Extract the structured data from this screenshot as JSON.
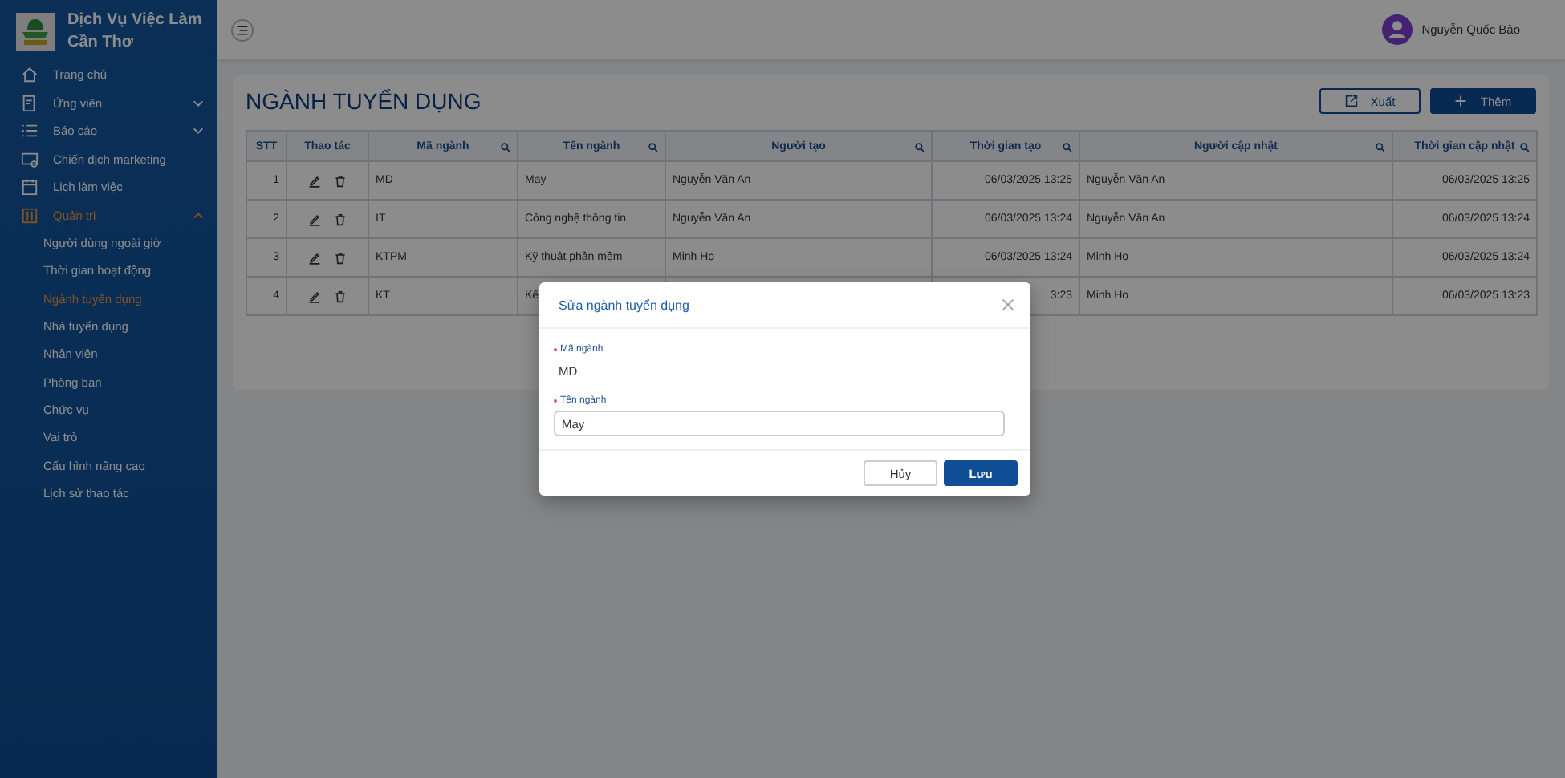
{
  "brand": {
    "title": "Dịch Vụ Việc Làm Cần Thơ"
  },
  "sidebar": {
    "items": [
      {
        "label": "Trang chủ",
        "selected": false
      },
      {
        "label": "Ứng viên",
        "selected": false,
        "expanded": false
      },
      {
        "label": "Báo cáo",
        "selected": false,
        "expanded": false
      },
      {
        "label": "Chiến dịch marketing",
        "selected": false
      },
      {
        "label": "Lịch làm việc",
        "selected": false
      },
      {
        "label": "Quản trị",
        "selected": true,
        "expanded": true,
        "children": [
          {
            "label": "Người dùng ngoài giờ",
            "selected": false
          },
          {
            "label": "Thời gian hoạt động",
            "selected": false
          },
          {
            "label": "Ngành tuyển dụng",
            "selected": true
          },
          {
            "label": "Nhà tuyển dụng",
            "selected": false
          },
          {
            "label": "Nhân viên",
            "selected": false
          },
          {
            "label": "Phòng ban",
            "selected": false
          },
          {
            "label": "Chức vụ",
            "selected": false
          },
          {
            "label": "Vai trò",
            "selected": false
          },
          {
            "label": "Cấu hình nâng cao",
            "selected": false
          },
          {
            "label": "Lịch sử thao tác",
            "selected": false
          }
        ]
      }
    ]
  },
  "user": {
    "name": "Nguyễn Quốc Bảo"
  },
  "page": {
    "title": "NGÀNH TUYỂN DỤNG",
    "buttons": [
      {
        "label": "Xuất",
        "kind": "export"
      },
      {
        "label": "Thêm",
        "kind": "add"
      }
    ]
  },
  "table": {
    "columns": [
      {
        "label": "STT",
        "kind": "index",
        "searchable": false
      },
      {
        "label": "Thao tác",
        "kind": "actions",
        "searchable": false
      },
      {
        "label": "Mã ngành",
        "kind": "text",
        "searchable": true
      },
      {
        "label": "Tên ngành",
        "kind": "text",
        "searchable": true
      },
      {
        "label": "Người tạo",
        "kind": "text",
        "searchable": true
      },
      {
        "label": "Thời gian tạo",
        "kind": "datetime",
        "searchable": true
      },
      {
        "label": "Người cập nhật",
        "kind": "text",
        "searchable": true
      },
      {
        "label": "Thời gian cập nhật",
        "kind": "datetime",
        "searchable": true
      }
    ],
    "rows": [
      {
        "cells": [
          "1",
          "",
          "MD",
          "May",
          "Nguyễn Văn An",
          "06/03/2025 13:25",
          "Nguyễn Văn An",
          "06/03/2025 13:25"
        ]
      },
      {
        "cells": [
          "2",
          "",
          "IT",
          "Công nghệ thông tin",
          "Nguyễn Văn An",
          "06/03/2025 13:24",
          "Nguyễn Văn An",
          "06/03/2025 13:24"
        ]
      },
      {
        "cells": [
          "3",
          "",
          "KTPM",
          "Kỹ thuật phần mềm",
          "Minh Ho",
          "06/03/2025 13:24",
          "Minh Ho",
          "06/03/2025 13:24"
        ]
      },
      {
        "cells": [
          "4",
          "",
          "KT",
          "Kế",
          null,
          "3:23",
          "Minh Ho",
          "06/03/2025 13:23"
        ]
      }
    ]
  },
  "dialog": {
    "title": "Sửa ngành tuyển dụng",
    "fields": [
      {
        "label": "Mã ngành",
        "required": true,
        "kind": "static",
        "value": "MD"
      },
      {
        "label": "Tên ngành",
        "required": true,
        "kind": "input",
        "value": "May"
      }
    ],
    "buttons": [
      {
        "label": "Hủy",
        "kind": "secondary"
      },
      {
        "label": "Lưu",
        "kind": "primary"
      }
    ]
  }
}
